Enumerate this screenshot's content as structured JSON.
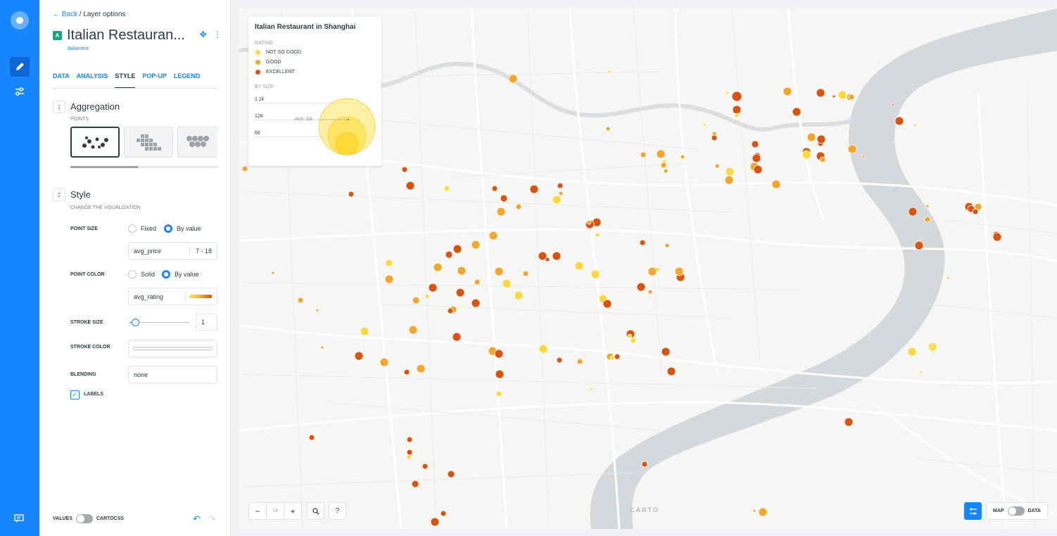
{
  "rail": {
    "items": [
      {
        "name": "builder-logo",
        "icon": "circle-logo-icon"
      },
      {
        "name": "edit",
        "icon": "pencil-icon",
        "active": true
      },
      {
        "name": "settings",
        "icon": "sliders-icon"
      }
    ],
    "chat_icon": "chat-icon"
  },
  "panel": {
    "back_label": "Back",
    "crumb_current": "/ Layer options",
    "layer_letter": "A",
    "layer_title": "Italian Restauran...",
    "layer_source": "italianrest",
    "tabs": [
      "DATA",
      "ANALYSIS",
      "STYLE",
      "POP-UP",
      "LEGEND"
    ],
    "active_tab": "STYLE",
    "aggregation": {
      "number": "1",
      "title": "Aggregation",
      "subtitle": "POINTS",
      "options": [
        "points",
        "squares",
        "hexbins"
      ],
      "selected": "points"
    },
    "style": {
      "number": "2",
      "title": "Style",
      "subtitle": "CHANGE THE VISUALIZATION",
      "point_size": {
        "label": "POINT SIZE",
        "opt1": "Fixed",
        "opt2": "By value",
        "selected": "By value",
        "field": "avg_price",
        "range": "7 - 18"
      },
      "point_color": {
        "label": "POINT COLOR",
        "opt1": "Solid",
        "opt2": "By value",
        "selected": "By value",
        "field": "avg_rating"
      },
      "stroke_size": {
        "label": "STROKE SIZE",
        "value": "1",
        "slider_fraction": 0.1
      },
      "stroke_color": {
        "label": "STROKE COLOR"
      },
      "blending": {
        "label": "BLENDING",
        "value": "none"
      },
      "labels": {
        "label": "LABELS",
        "checked": true
      }
    },
    "footer": {
      "values_label": "VALUES",
      "cartocss_label": "CARTOCSS"
    }
  },
  "legend": {
    "title": "Italian Restaurant in Shanghai",
    "rating_label": "RATING",
    "items": [
      {
        "label": "NOT SO GOOD",
        "color": "#ffd83f"
      },
      {
        "label": "GOOD",
        "color": "#f3a62c"
      },
      {
        "label": "EXCELLENT",
        "color": "#d95410"
      }
    ],
    "size_label": "BY SIZE",
    "size_ticks": [
      "1.1k",
      "128",
      "66"
    ],
    "avg_label": "AVG: 116"
  },
  "map": {
    "zoom_out": "−",
    "zoom_level": "14",
    "zoom_in": "+",
    "search_icon": "search-icon",
    "help": "?",
    "attribution": "CARTO",
    "map_label": "MAP",
    "data_label": "DATA",
    "colors": {
      "not_so_good": "#ffd83f",
      "good": "#f3a62c",
      "excellent": "#d95410",
      "water": "#d6d9dc",
      "road": "#ffffff"
    }
  }
}
